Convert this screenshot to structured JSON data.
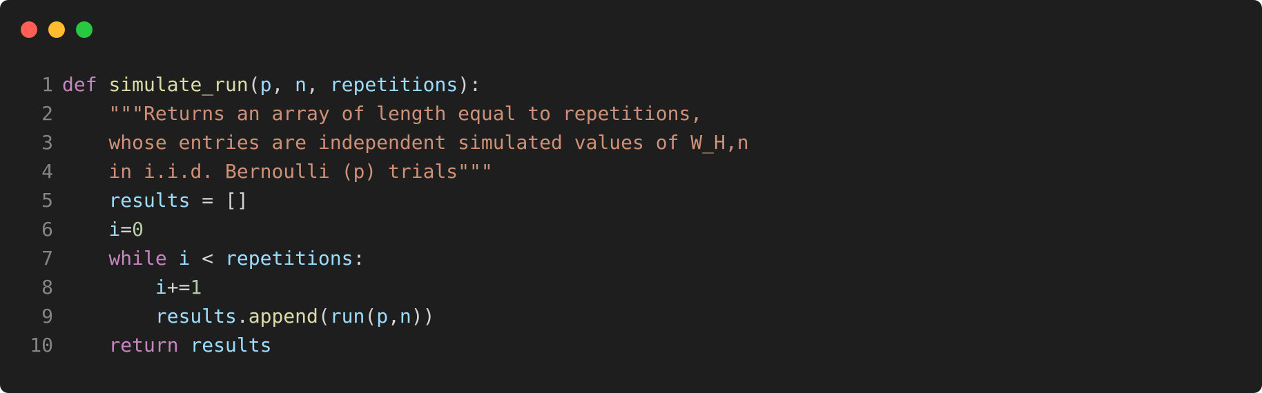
{
  "window": {
    "controls": [
      "close",
      "minimize",
      "zoom"
    ],
    "colors": {
      "close": "#ff5f57",
      "minimize": "#febc2e",
      "zoom": "#28c840"
    }
  },
  "editor": {
    "language": "python",
    "theme_colors": {
      "background": "#1e1e1e",
      "keyword": "#c586c0",
      "function": "#dcdcaa",
      "variable": "#9cdcfe",
      "string": "#ce9178",
      "number": "#b5cea8",
      "line_number": "#858585"
    },
    "lines": [
      {
        "number": "1",
        "tokens": [
          {
            "t": "def",
            "c": "kw"
          },
          {
            "t": " ",
            "c": "pn"
          },
          {
            "t": "simulate_run",
            "c": "fn"
          },
          {
            "t": "(",
            "c": "pn"
          },
          {
            "t": "p",
            "c": "var"
          },
          {
            "t": ", ",
            "c": "pn"
          },
          {
            "t": "n",
            "c": "var"
          },
          {
            "t": ", ",
            "c": "pn"
          },
          {
            "t": "repetitions",
            "c": "var"
          },
          {
            "t": "):",
            "c": "pn"
          }
        ]
      },
      {
        "number": "2",
        "tokens": [
          {
            "t": "    ",
            "c": "pn"
          },
          {
            "t": "\"\"\"Returns an array of length equal to repetitions,",
            "c": "str"
          }
        ]
      },
      {
        "number": "3",
        "tokens": [
          {
            "t": "    ",
            "c": "pn"
          },
          {
            "t": "whose entries are independent simulated values of W_H,n",
            "c": "str"
          }
        ]
      },
      {
        "number": "4",
        "tokens": [
          {
            "t": "    ",
            "c": "pn"
          },
          {
            "t": "in i.i.d. Bernoulli (p) trials\"\"\"",
            "c": "str"
          }
        ]
      },
      {
        "number": "5",
        "tokens": [
          {
            "t": "    ",
            "c": "pn"
          },
          {
            "t": "results",
            "c": "var"
          },
          {
            "t": " = []",
            "c": "pn"
          }
        ]
      },
      {
        "number": "6",
        "tokens": [
          {
            "t": "    ",
            "c": "pn"
          },
          {
            "t": "i",
            "c": "var"
          },
          {
            "t": "=",
            "c": "pn"
          },
          {
            "t": "0",
            "c": "num"
          }
        ]
      },
      {
        "number": "7",
        "tokens": [
          {
            "t": "    ",
            "c": "pn"
          },
          {
            "t": "while",
            "c": "kw"
          },
          {
            "t": " ",
            "c": "pn"
          },
          {
            "t": "i",
            "c": "var"
          },
          {
            "t": " < ",
            "c": "pn"
          },
          {
            "t": "repetitions",
            "c": "var"
          },
          {
            "t": ":",
            "c": "pn"
          }
        ]
      },
      {
        "number": "8",
        "tokens": [
          {
            "t": "        ",
            "c": "pn"
          },
          {
            "t": "i",
            "c": "var"
          },
          {
            "t": "+=",
            "c": "pn"
          },
          {
            "t": "1",
            "c": "num"
          }
        ]
      },
      {
        "number": "9",
        "tokens": [
          {
            "t": "        ",
            "c": "pn"
          },
          {
            "t": "results",
            "c": "var"
          },
          {
            "t": ".",
            "c": "pn"
          },
          {
            "t": "append",
            "c": "fn"
          },
          {
            "t": "(",
            "c": "pn"
          },
          {
            "t": "run",
            "c": "var"
          },
          {
            "t": "(",
            "c": "pn"
          },
          {
            "t": "p",
            "c": "var"
          },
          {
            "t": ",",
            "c": "pn"
          },
          {
            "t": "n",
            "c": "var"
          },
          {
            "t": "))",
            "c": "pn"
          }
        ]
      },
      {
        "number": "10",
        "tokens": [
          {
            "t": "    ",
            "c": "pn"
          },
          {
            "t": "return",
            "c": "kw"
          },
          {
            "t": " ",
            "c": "pn"
          },
          {
            "t": "results",
            "c": "var"
          }
        ]
      }
    ]
  }
}
